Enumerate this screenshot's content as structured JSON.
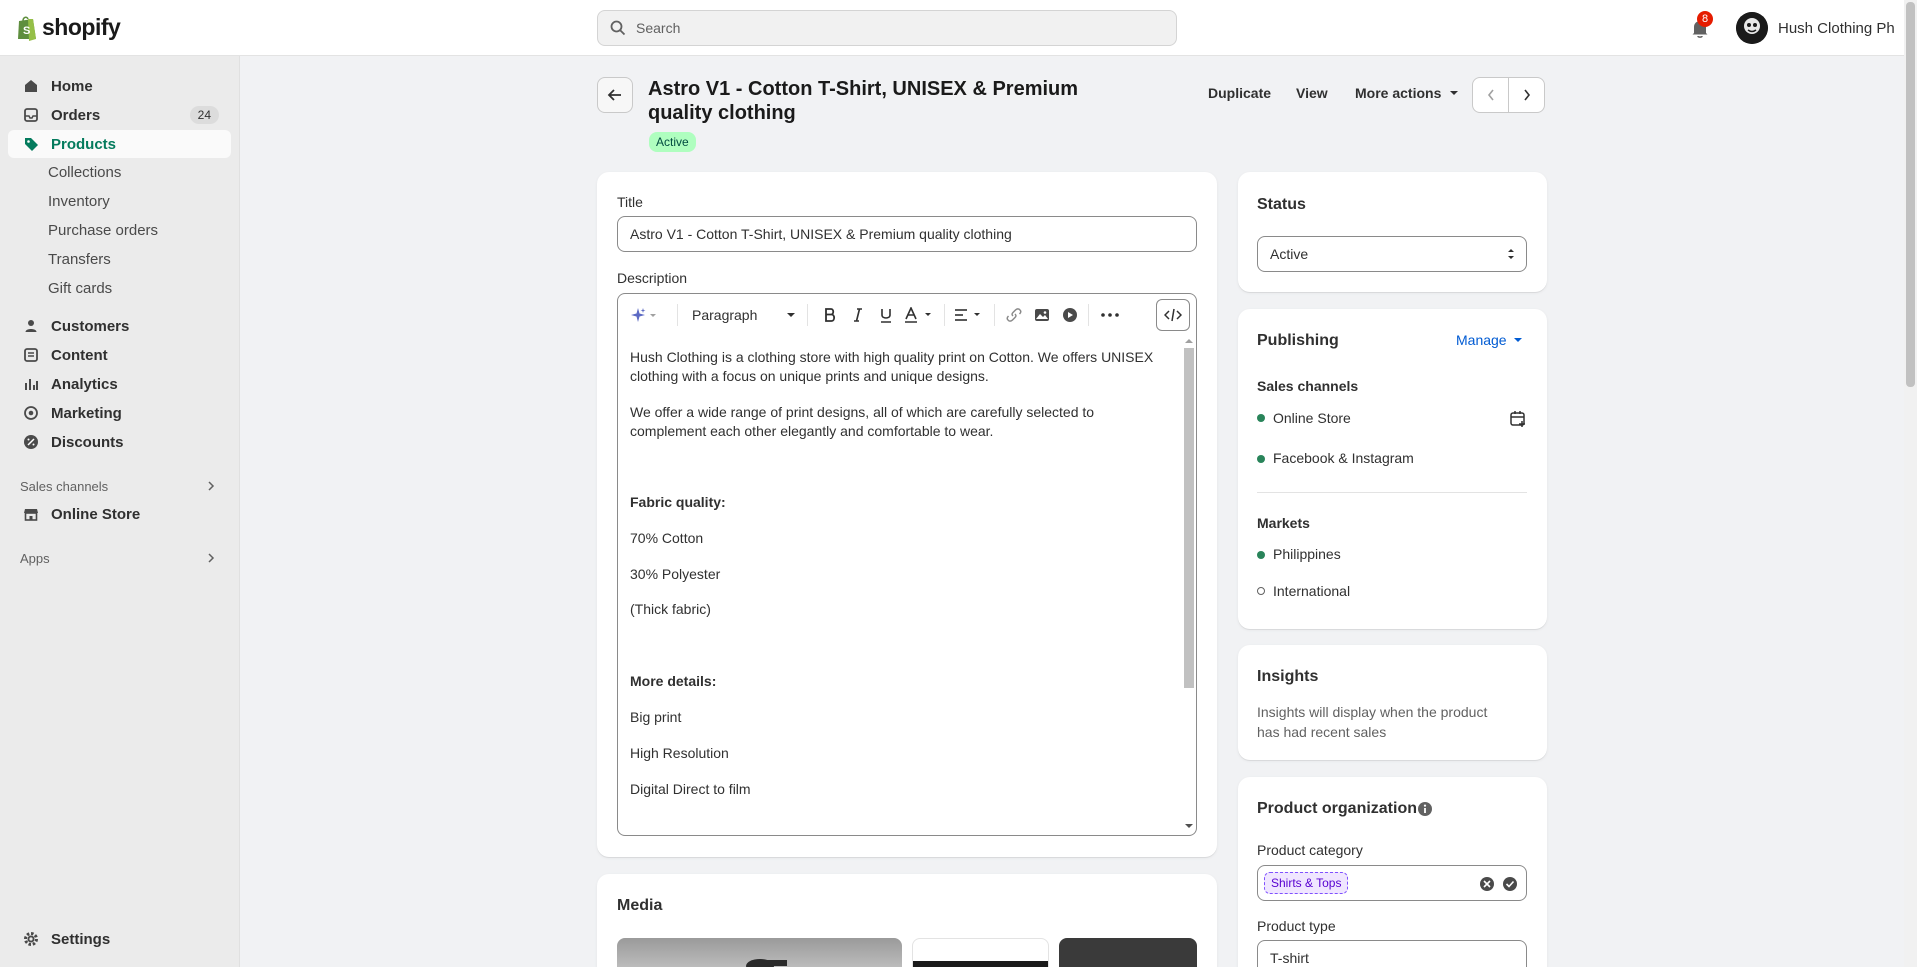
{
  "topbar": {
    "brand": "shopify",
    "search_placeholder": "Search",
    "notification_count": "8",
    "store_name": "Hush Clothing Ph"
  },
  "sidebar": {
    "home": "Home",
    "orders": "Orders",
    "orders_count": "24",
    "products": "Products",
    "sub_items": [
      "Collections",
      "Inventory",
      "Purchase orders",
      "Transfers",
      "Gift cards"
    ],
    "customers": "Customers",
    "content": "Content",
    "analytics": "Analytics",
    "marketing": "Marketing",
    "discounts": "Discounts",
    "sales_channels_label": "Sales channels",
    "online_store": "Online Store",
    "apps_label": "Apps",
    "settings": "Settings"
  },
  "header": {
    "title": "Astro V1 - Cotton T-Shirt, UNISEX & Premium quality clothing",
    "status": "Active",
    "duplicate": "Duplicate",
    "view": "View",
    "more_actions": "More actions"
  },
  "product": {
    "title_label": "Title",
    "title_value": "Astro V1 - Cotton T-Shirt, UNISEX & Premium quality clothing",
    "description_label": "Description",
    "paragraph_style": "Paragraph",
    "description": {
      "p1": "Hush Clothing is a clothing store with high quality print on Cotton. We offers UNISEX clothing with a focus on unique prints and unique designs.",
      "p2": "We offer a wide range of print designs, all of which are carefully selected to complement each other elegantly and comfortable to wear.",
      "fabric_heading": "Fabric quality:",
      "fabric_1": "70% Cotton",
      "fabric_2": "30% Polyester",
      "fabric_3": "(Thick fabric)",
      "details_heading": "More details:",
      "detail_1": "Big print",
      "detail_2": "High Resolution",
      "detail_3": "Digital Direct to film"
    },
    "media_title": "Media"
  },
  "status_card": {
    "title": "Status",
    "value": "Active"
  },
  "publishing": {
    "title": "Publishing",
    "manage": "Manage",
    "sales_channels_label": "Sales channels",
    "channels": [
      "Online Store",
      "Facebook & Instagram"
    ],
    "markets_label": "Markets",
    "markets": [
      "Philippines",
      "International"
    ]
  },
  "insights": {
    "title": "Insights",
    "text": "Insights will display when the product has had recent sales"
  },
  "organization": {
    "title": "Product organization",
    "category_label": "Product category",
    "category_tag": "Shirts & Tops",
    "type_label": "Product type",
    "type_value": "T-shirt"
  },
  "colors": {
    "accent": "#047b5d",
    "active_pill": "#affebf",
    "link": "#005bd3"
  }
}
